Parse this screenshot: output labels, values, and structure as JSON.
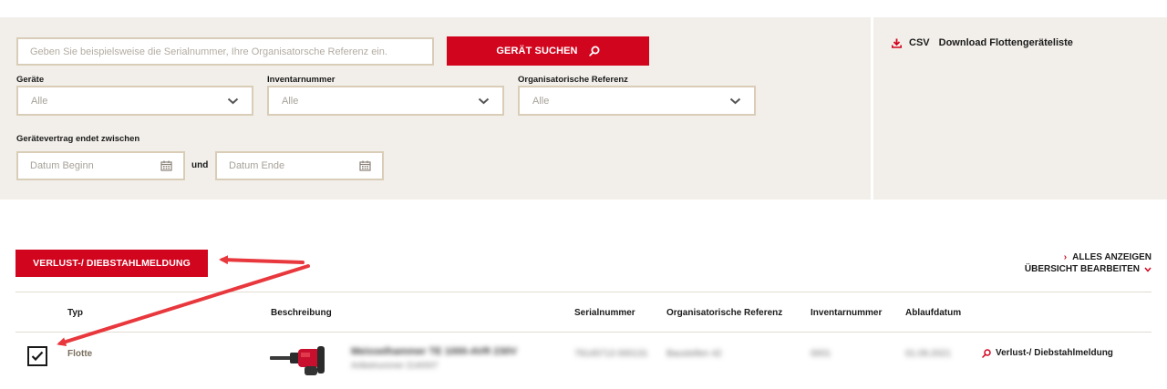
{
  "search": {
    "placeholder": "Geben Sie beispielsweise die Serialnummer, Ihre Organisatorsche Referenz ein.",
    "button_label": "GERÄT SUCHEN"
  },
  "filters": {
    "geraete": {
      "label": "Geräte",
      "value": "Alle"
    },
    "inventarnummer": {
      "label": "Inventarnummer",
      "value": "Alle"
    },
    "org_referenz": {
      "label": "Organisatorische Referenz",
      "value": "Alle"
    },
    "vertrag": {
      "label": "Gerätevertrag endet zwischen",
      "start_placeholder": "Datum Beginn",
      "connector": "und",
      "end_placeholder": "Datum Ende"
    }
  },
  "export": {
    "format": "CSV",
    "label": "Download Flottengeräteliste"
  },
  "actions": {
    "loss_button": "VERLUST-/ DIEBSTAHLMELDUNG",
    "show_all": "ALLES ANZEIGEN",
    "edit_overview": "ÜBERSICHT BEARBEITEN"
  },
  "table": {
    "columns": [
      "Typ",
      "Beschreibung",
      "Serialnummer",
      "Organisatorische Referenz",
      "Inventarnummer",
      "Ablaufdatum"
    ],
    "rows": [
      {
        "typ": "Flotte",
        "beschreibung": "Meisselhammer TE 1000-AVR 230V",
        "beschreibung_sub": "Artikelnummer 2140007",
        "serialnummer": "79145713 000131",
        "org_referenz": "Baustellen 42",
        "inventarnummer": "0001",
        "ablaufdatum": "01.09.2021",
        "action_label": "Verlust-/ Diebstahlmeldung",
        "checked": true
      }
    ]
  },
  "colors": {
    "accent": "#d2051e",
    "panel": "#f2efea",
    "border": "#d9cdb8"
  }
}
